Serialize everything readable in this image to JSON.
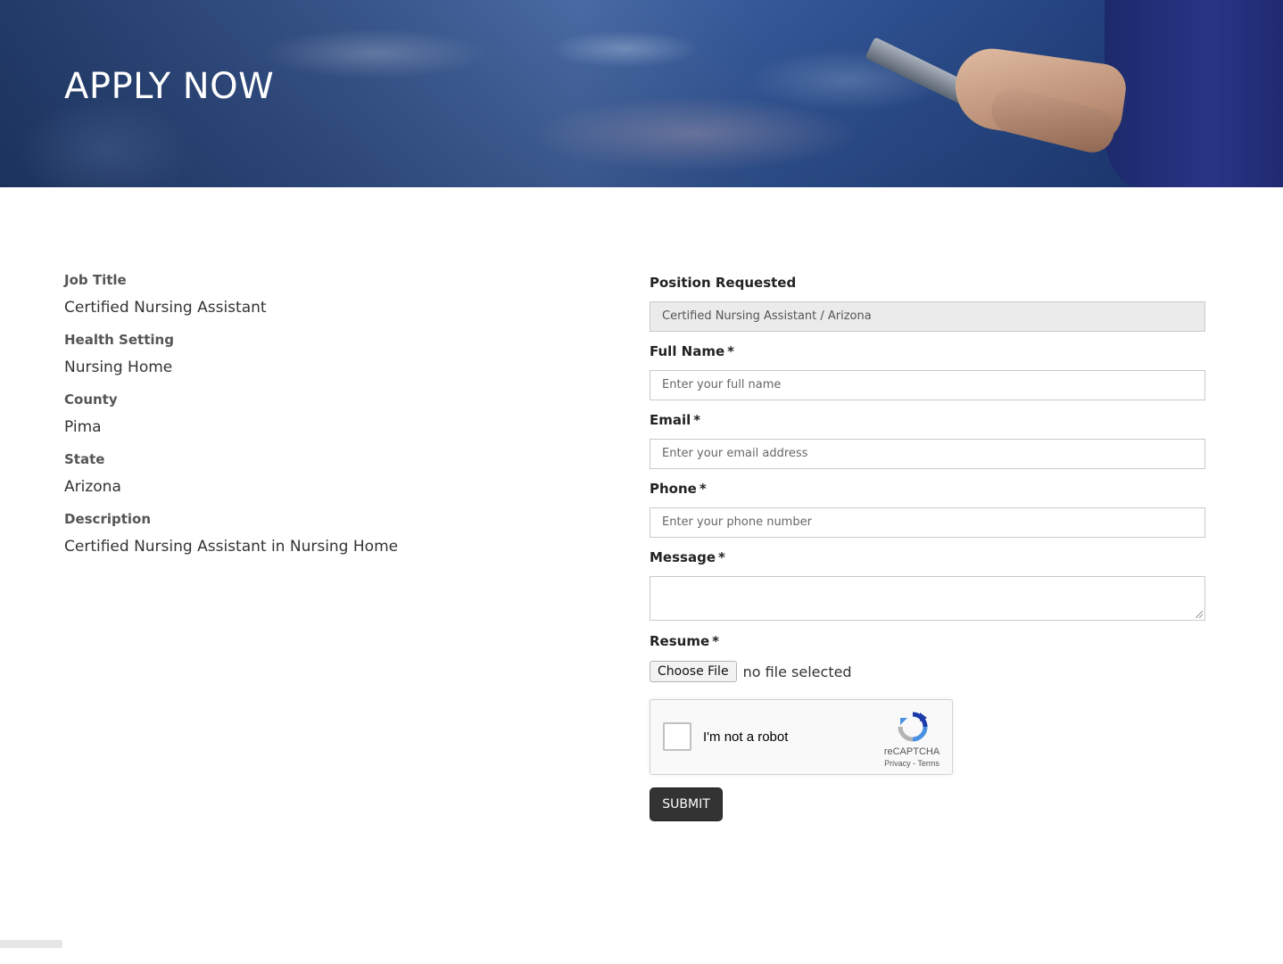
{
  "hero": {
    "title": "APPLY NOW"
  },
  "job_details": [
    {
      "label": "Job Title",
      "value": "Certified Nursing Assistant"
    },
    {
      "label": "Health Setting",
      "value": "Nursing Home"
    },
    {
      "label": "County",
      "value": "Pima"
    },
    {
      "label": "State",
      "value": "Arizona"
    },
    {
      "label": "Description",
      "value": "Certified Nursing Assistant in Nursing Home"
    }
  ],
  "form": {
    "position": {
      "label": "Position Requested",
      "value": "Certified Nursing Assistant / Arizona"
    },
    "full_name": {
      "label": "Full Name",
      "required": "*",
      "placeholder": "Enter your full name"
    },
    "email": {
      "label": "Email",
      "required": "*",
      "placeholder": "Enter your email address"
    },
    "phone": {
      "label": "Phone",
      "required": "*",
      "placeholder": "Enter your phone number"
    },
    "message": {
      "label": "Message",
      "required": "*"
    },
    "resume": {
      "label": "Resume",
      "required": "*",
      "button": "Choose File",
      "status": "no file selected"
    },
    "captcha": {
      "text": "I'm not a robot",
      "brand": "reCAPTCHA",
      "links": "Privacy - Terms",
      "logo_icon": "recaptcha-icon"
    },
    "submit": "SUBMIT"
  },
  "colors": {
    "submit_bg": "#333333",
    "hero_blue": "#3b63a8"
  }
}
